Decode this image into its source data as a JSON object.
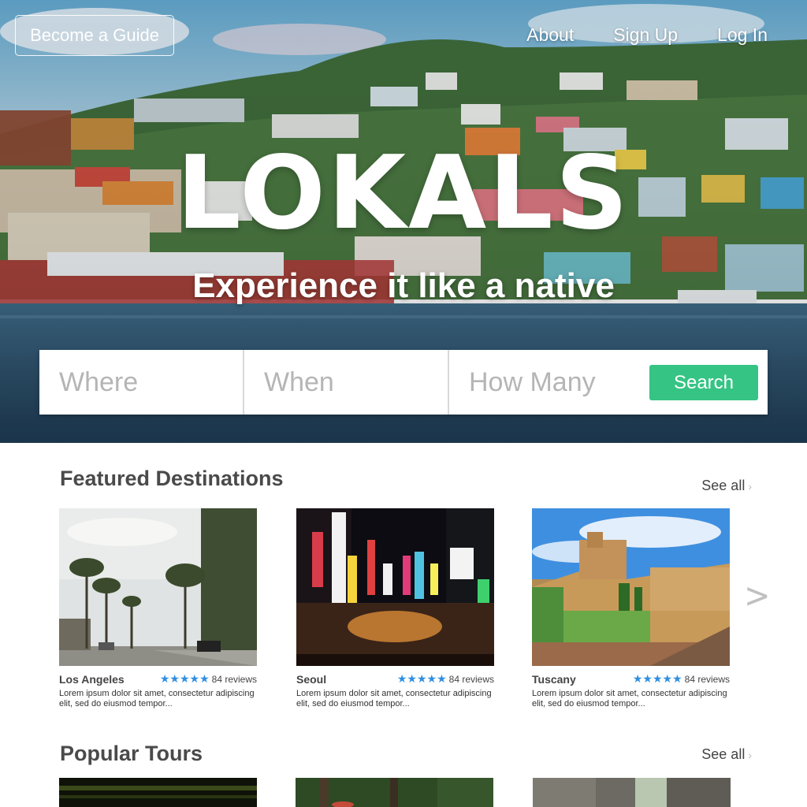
{
  "header": {
    "become_guide": "Become a Guide",
    "nav": [
      "About",
      "Sign Up",
      "Log In"
    ]
  },
  "hero": {
    "brand": "LOKALS",
    "tagline": "Experience it like a native"
  },
  "search": {
    "where_placeholder": "Where",
    "when_placeholder": "When",
    "how_many_placeholder": "How Many",
    "button": "Search"
  },
  "featured": {
    "title": "Featured Destinations",
    "see_all": "See all",
    "cards": [
      {
        "name": "Los Angeles",
        "stars": "★★★★★",
        "reviews": "84 reviews",
        "desc": "Lorem ipsum dolor sit amet, consectetur adipiscing elit, sed do eiusmod tempor..."
      },
      {
        "name": "Seoul",
        "stars": "★★★★★",
        "reviews": "84 reviews",
        "desc": "Lorem ipsum dolor sit amet, consectetur adipiscing elit, sed do eiusmod tempor..."
      },
      {
        "name": "Tuscany",
        "stars": "★★★★★",
        "reviews": "84 reviews",
        "desc": "Lorem ipsum dolor sit amet, consectetur adipiscing elit, sed do eiusmod tempor..."
      }
    ],
    "next_arrow": ">"
  },
  "popular": {
    "title": "Popular Tours",
    "see_all": "See all"
  },
  "colors": {
    "accent": "#35c484",
    "star": "#2e8fe0"
  }
}
